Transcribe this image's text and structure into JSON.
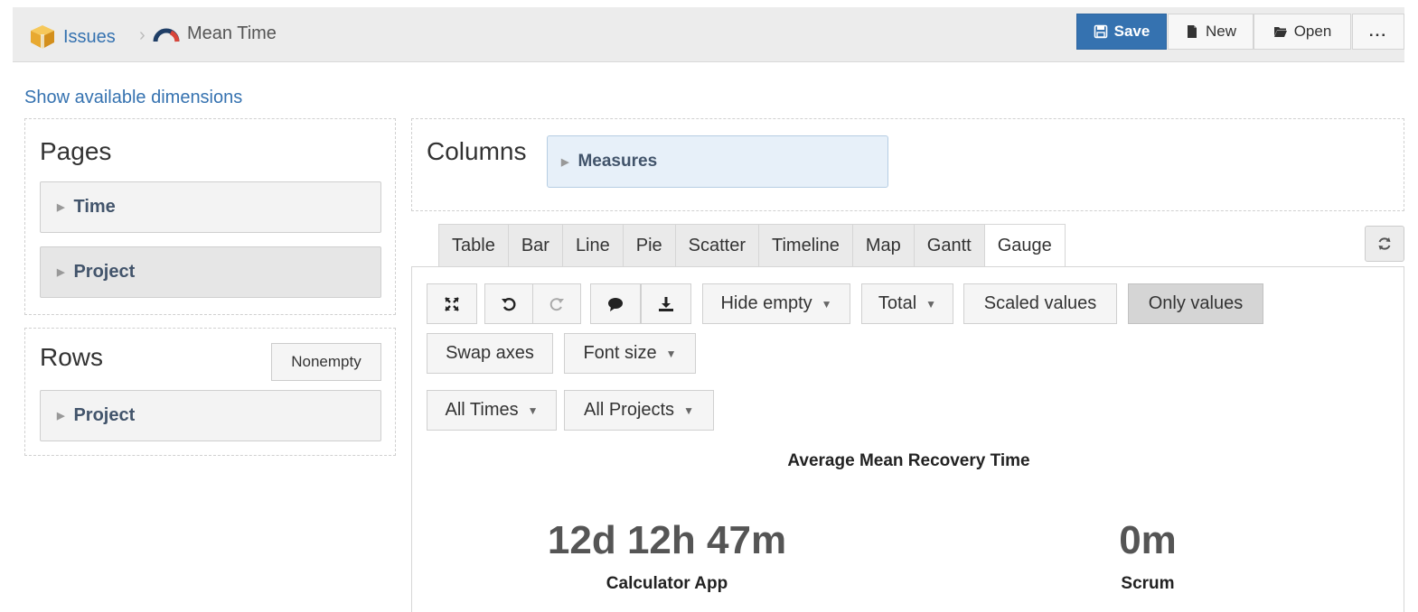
{
  "breadcrumb": {
    "root": "Issues",
    "current": "Mean Time"
  },
  "toolbar": {
    "save_label": "Save",
    "new_label": "New",
    "open_label": "Open",
    "more_label": "..."
  },
  "show_dimensions_link": "Show available dimensions",
  "pages": {
    "title": "Pages",
    "items": [
      "Time",
      "Project"
    ]
  },
  "rows": {
    "title": "Rows",
    "nonempty_label": "Nonempty",
    "items": [
      "Project"
    ]
  },
  "columns": {
    "title": "Columns",
    "items": [
      "Measures"
    ]
  },
  "tabs": [
    "Table",
    "Bar",
    "Line",
    "Pie",
    "Scatter",
    "Timeline",
    "Map",
    "Gantt",
    "Gauge"
  ],
  "active_tab": "Gauge",
  "controls": {
    "hide_empty": "Hide empty",
    "total": "Total",
    "scaled_values": "Scaled values",
    "only_values": "Only values",
    "swap_axes": "Swap axes",
    "font_size": "Font size",
    "all_times": "All Times",
    "all_projects": "All Projects"
  },
  "gauge": {
    "title": "Average Mean Recovery Time",
    "items": [
      {
        "value": "12d 12h 47m",
        "label": "Calculator App"
      },
      {
        "value": "0m",
        "label": "Scrum"
      }
    ]
  },
  "colors": {
    "accent": "#3572b0",
    "topbar_bg": "#ececec",
    "dimension_text": "#42546b"
  }
}
